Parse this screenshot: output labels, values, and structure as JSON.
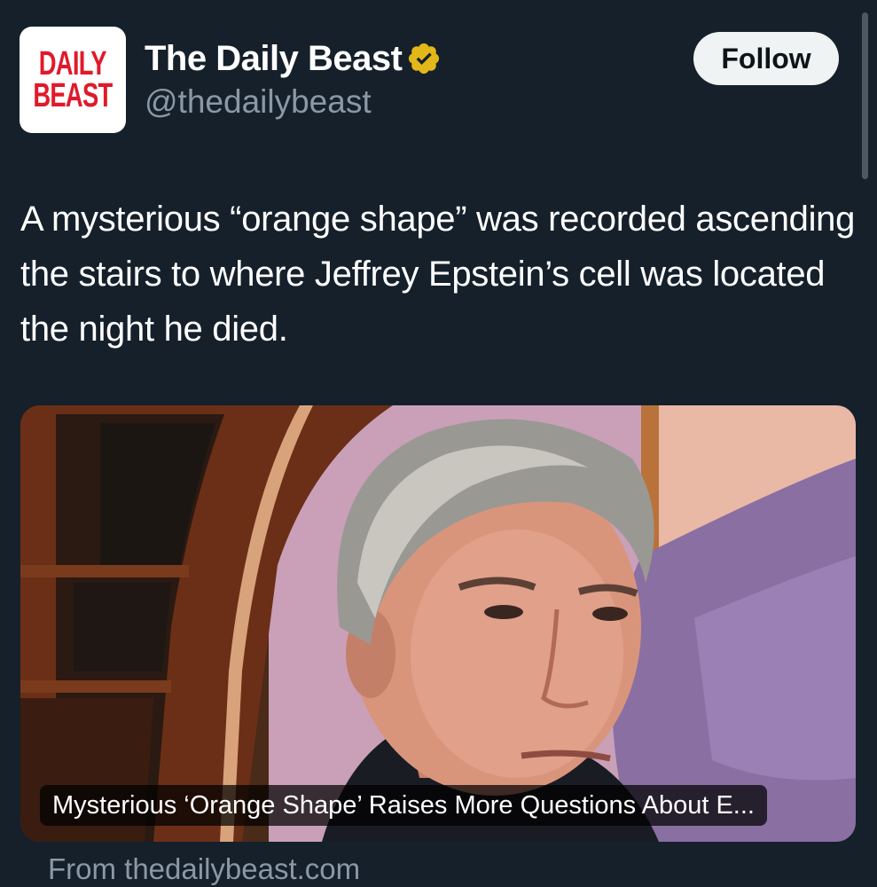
{
  "account": {
    "display_name": "The Daily Beast",
    "handle": "@thedailybeast",
    "avatar_logo_line1": "DAILY",
    "avatar_logo_line2": "BEAST",
    "verified_icon": "verified-badge-icon"
  },
  "actions": {
    "follow_label": "Follow"
  },
  "tweet": {
    "text": "A mysterious “orange shape” was recorded ascending the stairs to where Jeffrey Epstein’s cell was located the night he died."
  },
  "link_card": {
    "caption": "Mysterious ‘Orange Shape’ Raises More Questions About E...",
    "source": "From thedailybeast.com"
  },
  "colors": {
    "background": "#15202b",
    "secondary_text": "#8b98a5",
    "follow_button_bg": "#eff3f4",
    "verified_gold": "#e2b719",
    "brand_red": "#e01a2b"
  }
}
